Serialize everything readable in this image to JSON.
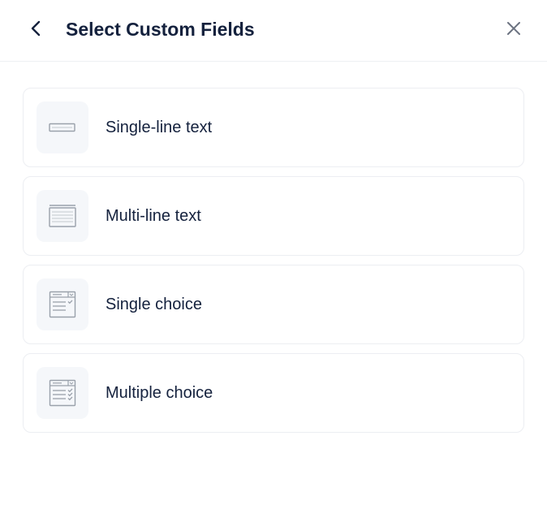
{
  "header": {
    "title": "Select Custom Fields",
    "back_icon": "chevron-left-icon",
    "close_icon": "close-icon"
  },
  "options": [
    {
      "label": "Single-line text",
      "icon": "single-line-text-icon"
    },
    {
      "label": "Multi-line text",
      "icon": "multi-line-text-icon"
    },
    {
      "label": "Single choice",
      "icon": "single-choice-icon"
    },
    {
      "label": "Multiple choice",
      "icon": "multiple-choice-icon"
    }
  ],
  "colors": {
    "text": "#14213d",
    "icon_stroke": "#9aa1ab",
    "icon_bg": "#f5f7fa",
    "card_border": "#eceef2"
  }
}
